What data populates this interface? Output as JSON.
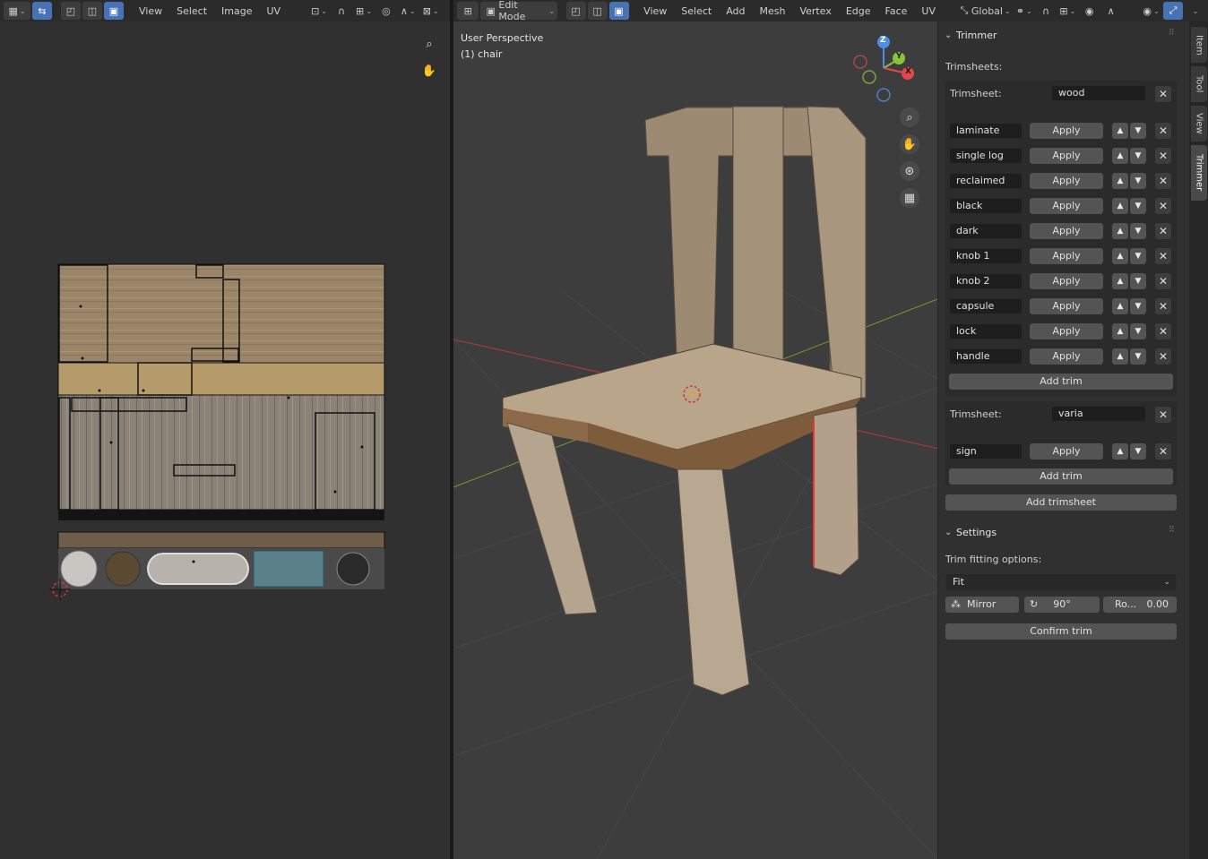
{
  "uv_header": {
    "menu": [
      "View",
      "Select",
      "Image",
      "UV"
    ]
  },
  "vp_header": {
    "mode": "Edit Mode",
    "menu": [
      "View",
      "Select",
      "Add",
      "Mesh",
      "Vertex",
      "Edge",
      "Face",
      "UV"
    ],
    "orientation": "Global"
  },
  "viewport": {
    "perspective": "User Perspective",
    "object": "(1) chair"
  },
  "gizmo": {
    "z": "Z",
    "y": "Y",
    "x": "X"
  },
  "trimmer": {
    "title": "Trimmer",
    "trimsheets_label": "Trimsheets:",
    "trimsheet_label": "Trimsheet:",
    "apply_label": "Apply",
    "add_trim_label": "Add trim",
    "add_trimsheet_label": "Add trimsheet",
    "sheets": [
      {
        "name": "wood",
        "trims": [
          "laminate",
          "single log",
          "reclaimed",
          "black",
          "dark",
          "knob 1",
          "knob 2",
          "capsule",
          "lock",
          "handle"
        ]
      },
      {
        "name": "varia",
        "trims": [
          "sign"
        ]
      }
    ]
  },
  "settings": {
    "title": "Settings",
    "fitting_label": "Trim fitting options:",
    "fit_value": "Fit",
    "mirror_label": "Mirror",
    "rotation_value": "90°",
    "ro_label": "Ro...",
    "ro_value": "0.00",
    "confirm_label": "Confirm trim"
  },
  "tabs": [
    "Item",
    "Tool",
    "View",
    "Trimmer"
  ]
}
